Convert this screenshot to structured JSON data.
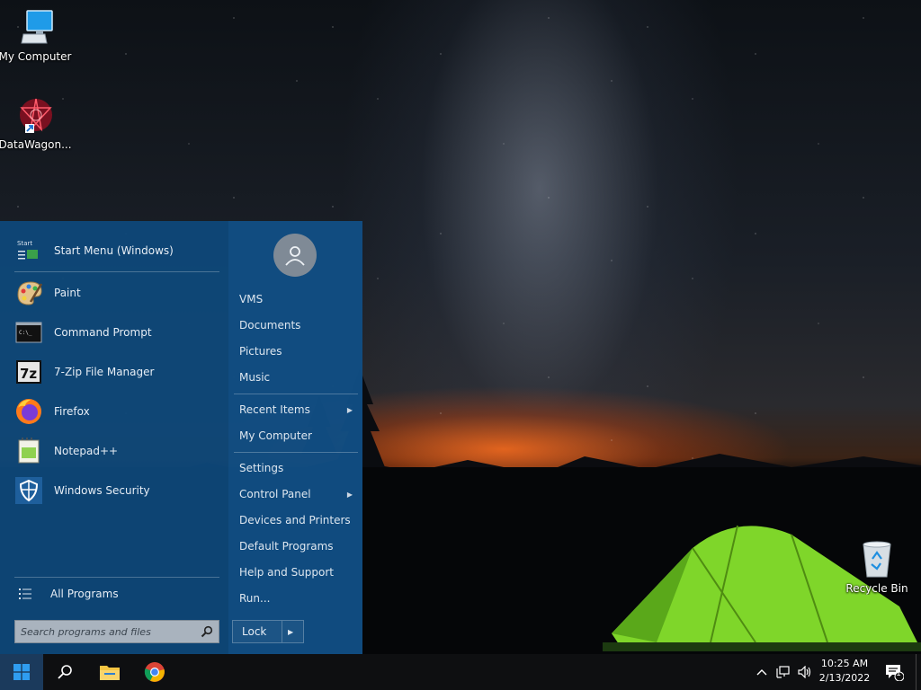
{
  "desktop": {
    "icons": [
      {
        "label": "My Computer",
        "icon": "monitor-icon"
      },
      {
        "label": "DataWagon...",
        "icon": "datawagon-shortcut-icon"
      },
      {
        "label": "Recycle Bin",
        "icon": "recycle-bin-icon"
      }
    ]
  },
  "start_menu": {
    "header": {
      "label": "Start Menu (Windows)",
      "icon_text": "Start"
    },
    "pinned_programs": [
      {
        "label": "Paint",
        "icon": "paint-palette-icon"
      },
      {
        "label": "Command Prompt",
        "icon": "command-prompt-icon",
        "icon_text": "C:\\_"
      },
      {
        "label": "7-Zip File Manager",
        "icon": "7zip-icon",
        "icon_text": "7z"
      },
      {
        "label": "Firefox",
        "icon": "firefox-icon"
      },
      {
        "label": "Notepad++",
        "icon": "notepad-plus-plus-icon"
      },
      {
        "label": "Windows Security",
        "icon": "shield-icon"
      }
    ],
    "all_programs": "All Programs",
    "search_placeholder": "Search programs and files",
    "right_items": [
      {
        "label": "VMS",
        "submenu": false
      },
      {
        "label": "Documents",
        "submenu": false
      },
      {
        "label": "Pictures",
        "submenu": false
      },
      {
        "label": "Music",
        "submenu": false
      },
      {
        "label": "Recent Items",
        "submenu": true
      },
      {
        "label": "My Computer",
        "submenu": false
      },
      {
        "label": "Settings",
        "submenu": false
      },
      {
        "label": "Control Panel",
        "submenu": true
      },
      {
        "label": "Devices and Printers",
        "submenu": false
      },
      {
        "label": "Default Programs",
        "submenu": false
      },
      {
        "label": "Help and Support",
        "submenu": false
      },
      {
        "label": "Run...",
        "submenu": false
      }
    ],
    "lock_label": "Lock"
  },
  "taskbar": {
    "pinned": [
      "windows-start-icon",
      "search-icon",
      "file-explorer-icon",
      "chrome-icon"
    ],
    "clock_time": "10:25 AM",
    "clock_date": "2/13/2022",
    "notification_count": "1"
  },
  "colors": {
    "start_menu_bg": "#0e487a",
    "taskbar_bg": "#0e0f11",
    "accent_blue": "#1a8fe6"
  }
}
